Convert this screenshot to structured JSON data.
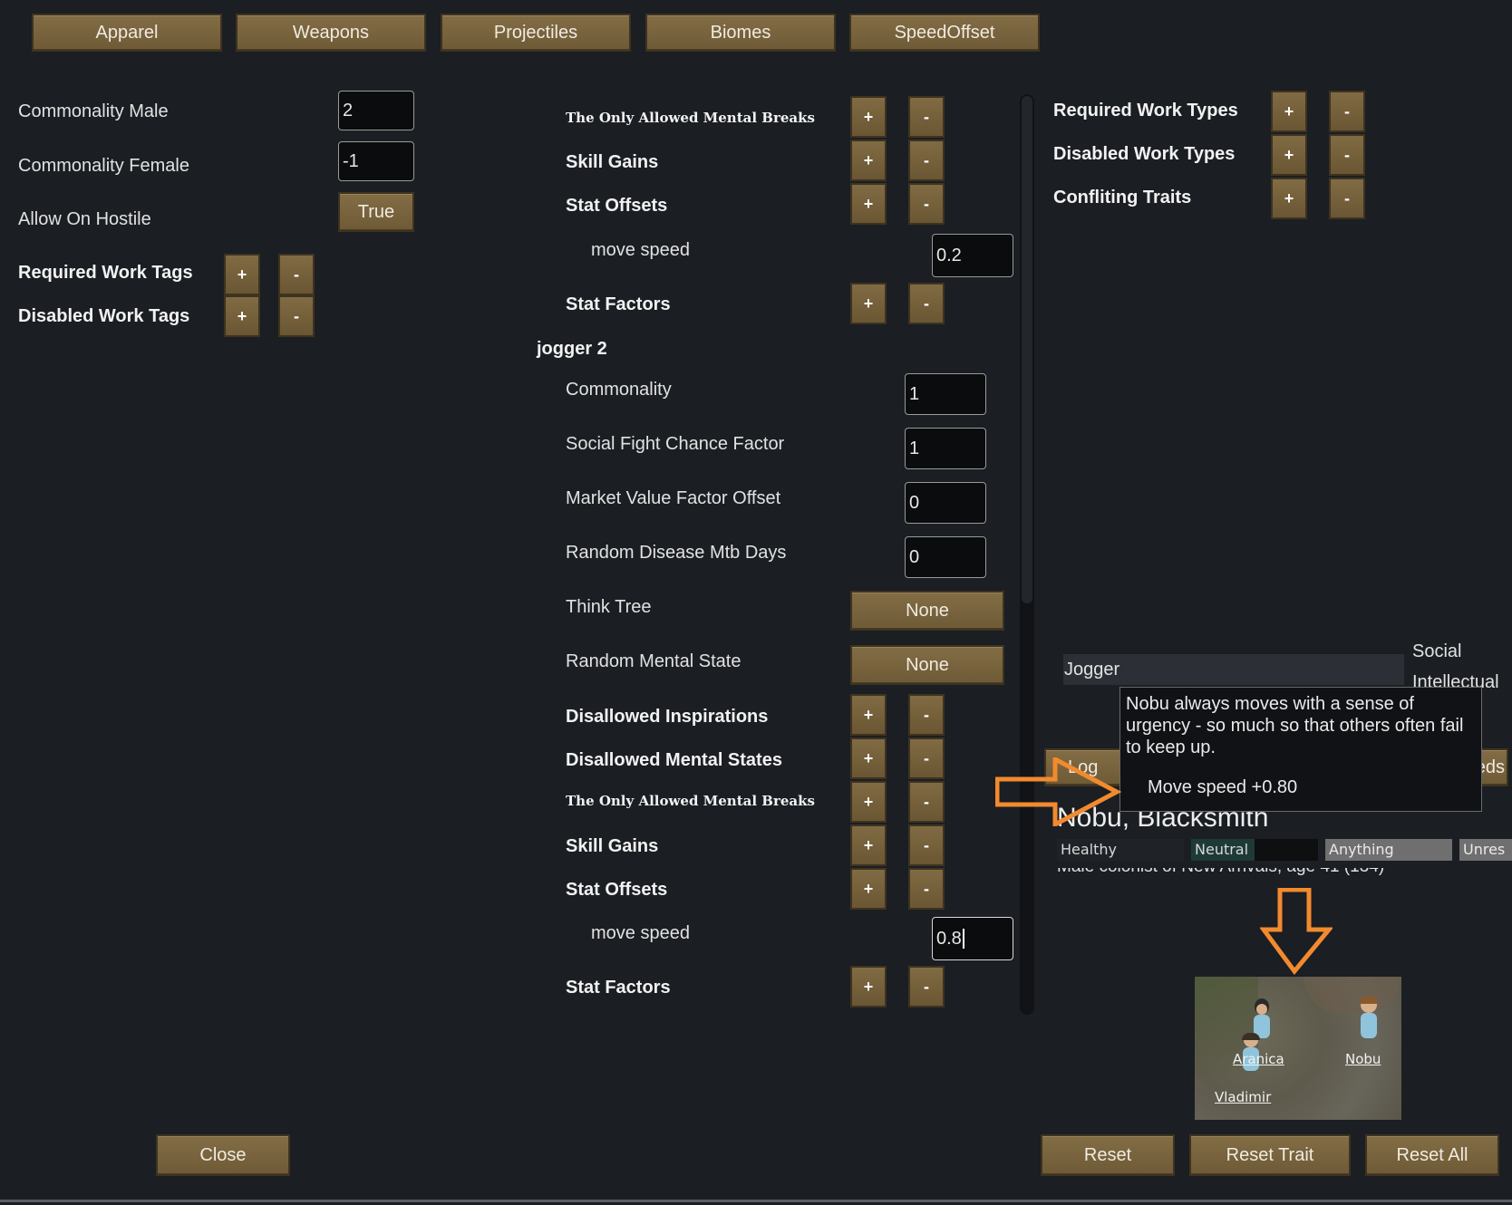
{
  "tabs": [
    "Apparel",
    "Weapons",
    "Projectiles",
    "Biomes",
    "SpeedOffset"
  ],
  "left": {
    "commonality_male": {
      "label": "Commonality Male",
      "value": "2"
    },
    "commonality_female": {
      "label": "Commonality Female",
      "value": "-1"
    },
    "allow_on_hostile": {
      "label": "Allow On Hostile",
      "value": "True"
    },
    "required_work_tags": "Required Work Tags",
    "disabled_work_tags": "Disabled Work Tags"
  },
  "middle": {
    "only_allowed_mental_breaks": "The Only Allowed Mental Breaks",
    "skill_gains": "Skill Gains",
    "stat_offsets": "Stat Offsets",
    "move_speed_label": "move speed",
    "move_speed_1": "0.2",
    "stat_factors": "Stat Factors",
    "section_title": "jogger  2",
    "commonality": {
      "label": "Commonality",
      "value": "1"
    },
    "social_fight": {
      "label": "Social Fight Chance Factor",
      "value": "1"
    },
    "market_value": {
      "label": "Market Value Factor Offset",
      "value": "0"
    },
    "random_disease": {
      "label": "Random Disease Mtb Days",
      "value": "0"
    },
    "think_tree": {
      "label": "Think Tree",
      "value": "None"
    },
    "random_mental_state": {
      "label": "Random Mental State",
      "value": "None"
    },
    "disallowed_inspirations": "Disallowed Inspirations",
    "disallowed_mental_states": "Disallowed Mental States",
    "move_speed_2": "0.8"
  },
  "right": {
    "required_work_types": "Required Work Types",
    "disabled_work_types": "Disabled Work Types",
    "conflicting_traits": "Confliting Traits"
  },
  "inspect": {
    "trait": "Jogger",
    "social": "Social",
    "intellectual_partial": "Intellectual",
    "log_tab": "Log",
    "needs_partial": "eds",
    "pawn_name": "Nobu, Blacksmith",
    "tags": [
      "Healthy",
      "Neutral",
      "Anything",
      "Unres"
    ],
    "desc_partial": "Male colonist of New Arrivals, age 41 (134)",
    "tooltip_text": "Nobu always moves with a sense of urgency - so much so that others often fail to keep up.",
    "tooltip_stat": "Move speed +0.80"
  },
  "map": {
    "pawns": [
      "Aranica",
      "Nobu",
      "Vladimir"
    ]
  },
  "bottom": {
    "close": "Close",
    "reset": "Reset",
    "reset_trait": "Reset Trait",
    "reset_all": "Reset All"
  },
  "colors": {
    "accent_orange": "#f28a2e",
    "button_brown": "#7a6540"
  }
}
